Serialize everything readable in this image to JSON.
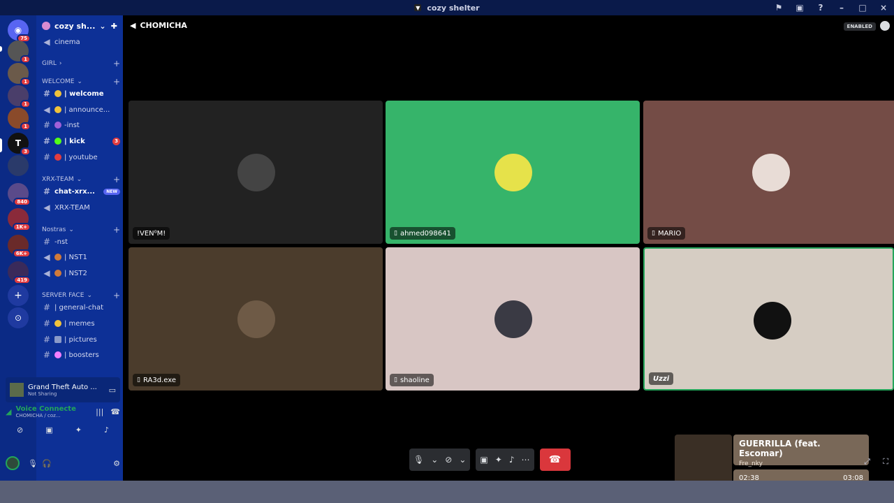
{
  "window": {
    "title": "cozy shelter"
  },
  "servers": [
    {
      "name": "discord-home",
      "badge": "75"
    },
    {
      "name": "server-1",
      "badge": "1"
    },
    {
      "name": "server-2",
      "badge": "1"
    },
    {
      "name": "server-3",
      "badge": "1"
    },
    {
      "name": "server-4",
      "badge": "1"
    },
    {
      "name": "server-5",
      "badge": "3"
    },
    {
      "name": "server-6",
      "badge": ""
    },
    {
      "name": "server-7",
      "badge": "840"
    },
    {
      "name": "server-8",
      "badge": "1K+"
    },
    {
      "name": "server-9",
      "badge": "6K+"
    },
    {
      "name": "server-10",
      "badge": "419"
    }
  ],
  "guild": {
    "name": "cozy sh..."
  },
  "channels": {
    "cinema": "cinema",
    "cat_girl": "GIRL",
    "cat_welcome": "WELCOME",
    "welcome": "| welcome",
    "announce": "| announce...",
    "inst": "-inst",
    "kick": "| kick",
    "kick_badge": "3",
    "youtube": "| youtube",
    "cat_xrx": "XRX-TEAM",
    "chat_xrx": "chat-xrx...",
    "chat_xrx_badge": "NEW",
    "xrx_team": "XRX-TEAM",
    "cat_nostras": "Nostras",
    "nst": "-nst",
    "nst1": "| NST1",
    "nst2": "| NST2",
    "cat_server_face": "SERVER FACE",
    "general_chat": "| general-chat",
    "memes": "| memes",
    "pictures": "| pictures",
    "boosters": "| boosters"
  },
  "activity": {
    "title": "Grand Theft Auto ...",
    "sub": "Not Sharing"
  },
  "voice": {
    "status": "Voice Connecte",
    "sub": "CHOMICHA / coz..."
  },
  "stage": {
    "channel": "CHOMICHA",
    "enabled": "ENABLED"
  },
  "participants": [
    {
      "name": "!VEN⁰M!",
      "bg": "#222222",
      "avatar": "#444444",
      "device": ""
    },
    {
      "name": "ahmed098641",
      "bg": "#36b46a",
      "avatar": "#e6e24a",
      "device": "▯"
    },
    {
      "name": "MARIO",
      "bg": "#744c46",
      "avatar": "#e8dcd6",
      "device": "▯"
    },
    {
      "name": "RA3d.exe",
      "bg": "#4b3c2c",
      "avatar": "#6e5a46",
      "device": "▯"
    },
    {
      "name": "shaoline",
      "bg": "#d8c6c4",
      "avatar": "#3a3a44",
      "device": "▯"
    },
    {
      "name": "Uzzi",
      "bg": "#d6cdc3",
      "avatar": "#111111",
      "device": ""
    }
  ],
  "nowplaying": {
    "song": "GUERRILLA (feat. Escomar)",
    "artist": "Fre_nky",
    "elapsed": "02:38",
    "total": "03:08",
    "progress": 0.84
  },
  "colors": {
    "accent": "#23a55a",
    "hangup": "#da373c",
    "sidebar": "#0d3096",
    "servers": "#0b2a85"
  }
}
